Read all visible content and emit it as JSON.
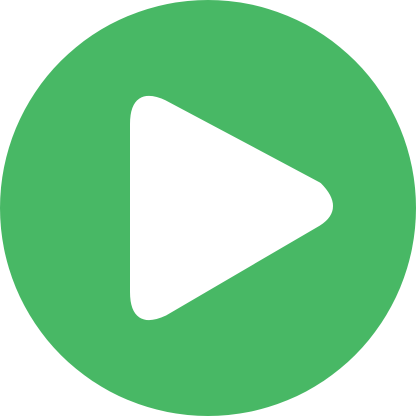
{
  "play_button": {
    "icon": "play-icon",
    "background_color": "#48b865",
    "glyph_color": "#ffffff"
  }
}
